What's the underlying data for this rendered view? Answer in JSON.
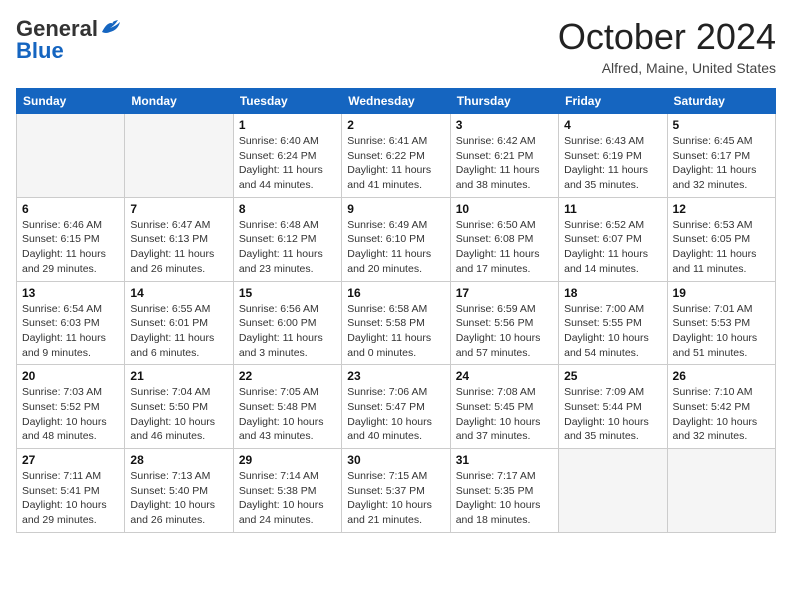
{
  "header": {
    "logo_line1": "General",
    "logo_line2": "Blue",
    "month": "October 2024",
    "location": "Alfred, Maine, United States"
  },
  "weekdays": [
    "Sunday",
    "Monday",
    "Tuesday",
    "Wednesday",
    "Thursday",
    "Friday",
    "Saturday"
  ],
  "weeks": [
    [
      {
        "day": "",
        "empty": true
      },
      {
        "day": "",
        "empty": true
      },
      {
        "day": "1",
        "sunrise": "6:40 AM",
        "sunset": "6:24 PM",
        "daylight": "11 hours and 44 minutes."
      },
      {
        "day": "2",
        "sunrise": "6:41 AM",
        "sunset": "6:22 PM",
        "daylight": "11 hours and 41 minutes."
      },
      {
        "day": "3",
        "sunrise": "6:42 AM",
        "sunset": "6:21 PM",
        "daylight": "11 hours and 38 minutes."
      },
      {
        "day": "4",
        "sunrise": "6:43 AM",
        "sunset": "6:19 PM",
        "daylight": "11 hours and 35 minutes."
      },
      {
        "day": "5",
        "sunrise": "6:45 AM",
        "sunset": "6:17 PM",
        "daylight": "11 hours and 32 minutes."
      }
    ],
    [
      {
        "day": "6",
        "sunrise": "6:46 AM",
        "sunset": "6:15 PM",
        "daylight": "11 hours and 29 minutes."
      },
      {
        "day": "7",
        "sunrise": "6:47 AM",
        "sunset": "6:13 PM",
        "daylight": "11 hours and 26 minutes."
      },
      {
        "day": "8",
        "sunrise": "6:48 AM",
        "sunset": "6:12 PM",
        "daylight": "11 hours and 23 minutes."
      },
      {
        "day": "9",
        "sunrise": "6:49 AM",
        "sunset": "6:10 PM",
        "daylight": "11 hours and 20 minutes."
      },
      {
        "day": "10",
        "sunrise": "6:50 AM",
        "sunset": "6:08 PM",
        "daylight": "11 hours and 17 minutes."
      },
      {
        "day": "11",
        "sunrise": "6:52 AM",
        "sunset": "6:07 PM",
        "daylight": "11 hours and 14 minutes."
      },
      {
        "day": "12",
        "sunrise": "6:53 AM",
        "sunset": "6:05 PM",
        "daylight": "11 hours and 11 minutes."
      }
    ],
    [
      {
        "day": "13",
        "sunrise": "6:54 AM",
        "sunset": "6:03 PM",
        "daylight": "11 hours and 9 minutes."
      },
      {
        "day": "14",
        "sunrise": "6:55 AM",
        "sunset": "6:01 PM",
        "daylight": "11 hours and 6 minutes."
      },
      {
        "day": "15",
        "sunrise": "6:56 AM",
        "sunset": "6:00 PM",
        "daylight": "11 hours and 3 minutes."
      },
      {
        "day": "16",
        "sunrise": "6:58 AM",
        "sunset": "5:58 PM",
        "daylight": "11 hours and 0 minutes."
      },
      {
        "day": "17",
        "sunrise": "6:59 AM",
        "sunset": "5:56 PM",
        "daylight": "10 hours and 57 minutes."
      },
      {
        "day": "18",
        "sunrise": "7:00 AM",
        "sunset": "5:55 PM",
        "daylight": "10 hours and 54 minutes."
      },
      {
        "day": "19",
        "sunrise": "7:01 AM",
        "sunset": "5:53 PM",
        "daylight": "10 hours and 51 minutes."
      }
    ],
    [
      {
        "day": "20",
        "sunrise": "7:03 AM",
        "sunset": "5:52 PM",
        "daylight": "10 hours and 48 minutes."
      },
      {
        "day": "21",
        "sunrise": "7:04 AM",
        "sunset": "5:50 PM",
        "daylight": "10 hours and 46 minutes."
      },
      {
        "day": "22",
        "sunrise": "7:05 AM",
        "sunset": "5:48 PM",
        "daylight": "10 hours and 43 minutes."
      },
      {
        "day": "23",
        "sunrise": "7:06 AM",
        "sunset": "5:47 PM",
        "daylight": "10 hours and 40 minutes."
      },
      {
        "day": "24",
        "sunrise": "7:08 AM",
        "sunset": "5:45 PM",
        "daylight": "10 hours and 37 minutes."
      },
      {
        "day": "25",
        "sunrise": "7:09 AM",
        "sunset": "5:44 PM",
        "daylight": "10 hours and 35 minutes."
      },
      {
        "day": "26",
        "sunrise": "7:10 AM",
        "sunset": "5:42 PM",
        "daylight": "10 hours and 32 minutes."
      }
    ],
    [
      {
        "day": "27",
        "sunrise": "7:11 AM",
        "sunset": "5:41 PM",
        "daylight": "10 hours and 29 minutes."
      },
      {
        "day": "28",
        "sunrise": "7:13 AM",
        "sunset": "5:40 PM",
        "daylight": "10 hours and 26 minutes."
      },
      {
        "day": "29",
        "sunrise": "7:14 AM",
        "sunset": "5:38 PM",
        "daylight": "10 hours and 24 minutes."
      },
      {
        "day": "30",
        "sunrise": "7:15 AM",
        "sunset": "5:37 PM",
        "daylight": "10 hours and 21 minutes."
      },
      {
        "day": "31",
        "sunrise": "7:17 AM",
        "sunset": "5:35 PM",
        "daylight": "10 hours and 18 minutes."
      },
      {
        "day": "",
        "empty": true
      },
      {
        "day": "",
        "empty": true
      }
    ]
  ]
}
